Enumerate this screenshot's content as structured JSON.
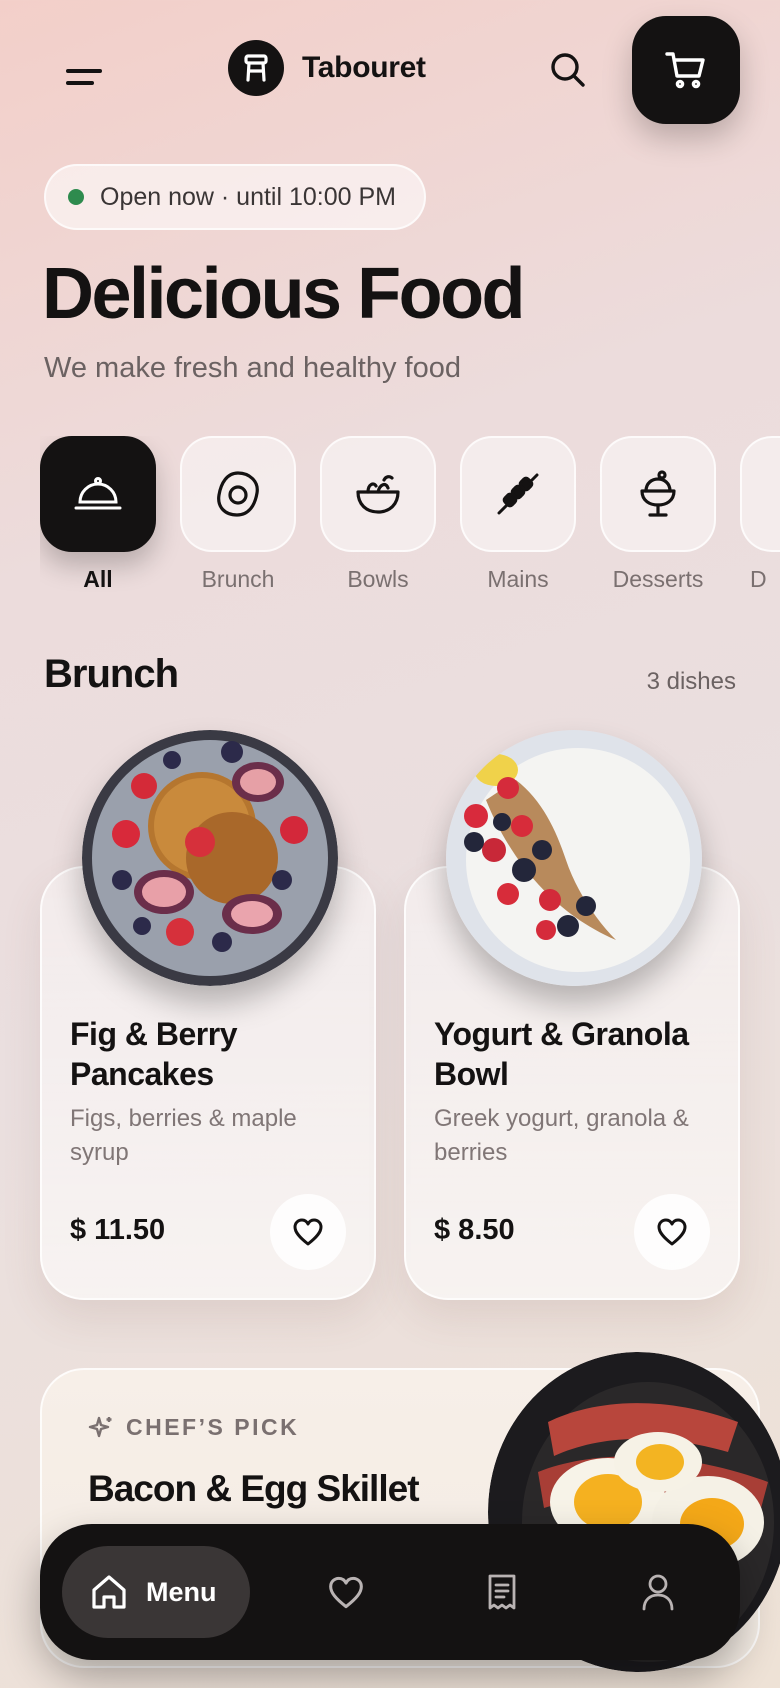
{
  "header": {
    "brand_name": "Tabouret",
    "menu_icon": "hamburger-icon",
    "logo_icon": "stool-icon",
    "search_icon": "search-icon",
    "cart_icon": "cart-icon"
  },
  "status": {
    "text": "Open now · until 10:00 PM",
    "dot_color": "#2e8b4e"
  },
  "hero": {
    "title": "Delicious Food",
    "subtitle": "We make fresh and healthy food"
  },
  "categories": [
    {
      "label": "All",
      "icon": "cloche-icon",
      "active": true
    },
    {
      "label": "Brunch",
      "icon": "egg-icon",
      "active": false
    },
    {
      "label": "Bowls",
      "icon": "bowl-icon",
      "active": false
    },
    {
      "label": "Mains",
      "icon": "skewer-icon",
      "active": false
    },
    {
      "label": "Desserts",
      "icon": "ice-cream-icon",
      "active": false
    },
    {
      "label": "D",
      "icon": "drink-icon",
      "active": false
    }
  ],
  "section": {
    "title": "Brunch",
    "count": "3 dishes"
  },
  "dishes": [
    {
      "name": "Fig & Berry Pancakes",
      "description": "Figs, berries & maple syrup",
      "price": "$ 11.50",
      "favorite_icon": "heart-icon"
    },
    {
      "name": "Yogurt & Granola Bowl",
      "description": "Greek yogurt, granola & berries",
      "price": "$ 8.50",
      "favorite_icon": "heart-icon"
    }
  ],
  "chef_pick": {
    "tag": "CHEF’S PICK",
    "title": "Bacon & Egg Skillet",
    "tag_icon": "sparkle-icon"
  },
  "bottom_nav": {
    "home_label": "Menu",
    "home_icon": "home-icon",
    "favorites_icon": "heart-icon",
    "orders_icon": "receipt-icon",
    "profile_icon": "user-icon"
  },
  "colors": {
    "accent_dark": "#141212",
    "muted_text": "#7a7070"
  }
}
